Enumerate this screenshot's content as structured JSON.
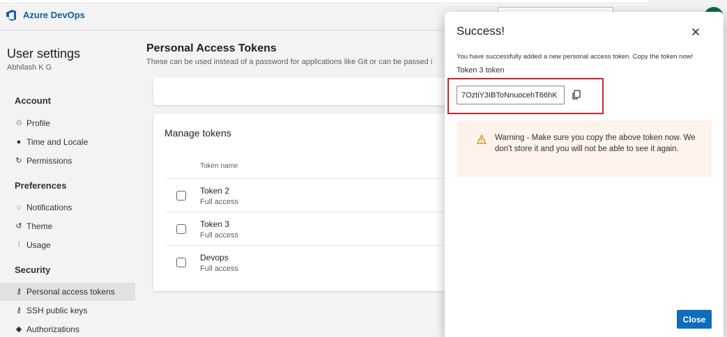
{
  "header": {
    "brand": "Azure DevOps"
  },
  "sidebar": {
    "title": "User settings",
    "user_name": "Abhilash K G",
    "groups": [
      {
        "title": "Account",
        "items": [
          {
            "label": "Profile",
            "icon": "profile-icon"
          },
          {
            "label": "Time and Locale",
            "icon": "globe-icon"
          },
          {
            "label": "Permissions",
            "icon": "permissions-icon"
          }
        ]
      },
      {
        "title": "Preferences",
        "items": [
          {
            "label": "Notifications",
            "icon": "notification-icon"
          },
          {
            "label": "Theme",
            "icon": "theme-icon"
          },
          {
            "label": "Usage",
            "icon": "usage-icon"
          }
        ]
      },
      {
        "title": "Security",
        "items": [
          {
            "label": "Personal access tokens",
            "icon": "key-icon",
            "active": true
          },
          {
            "label": "SSH public keys",
            "icon": "ssh-key-icon"
          },
          {
            "label": "Authorizations",
            "icon": "lock-icon"
          }
        ]
      }
    ]
  },
  "main": {
    "title": "Personal Access Tokens",
    "description": "These can be used instead of a password for applications like Git or can be passed i",
    "manage_heading": "Manage tokens",
    "column_token_name": "Token name",
    "tokens": [
      {
        "name": "Token 2",
        "scope": "Full access"
      },
      {
        "name": "Token 3",
        "scope": "Full access"
      },
      {
        "name": "Devops",
        "scope": "Full access"
      }
    ]
  },
  "dialog": {
    "title": "Success!",
    "close_glyph": "✕",
    "message": "You have successfully added a new personal access token. Copy the token now!",
    "token_label": "Token 3 token",
    "token_value": "7OztiY3IBToNnuocehT66hK",
    "warning_text": "Warning - Make sure you copy the above token now. We don't store it and you will not be able to see it again.",
    "close_button": "Close",
    "colors": {
      "primary": "#0f6cbd",
      "highlight": "#d1202f",
      "warning_bg": "#fdf3ea",
      "warning_icon": "#c58b00"
    }
  }
}
